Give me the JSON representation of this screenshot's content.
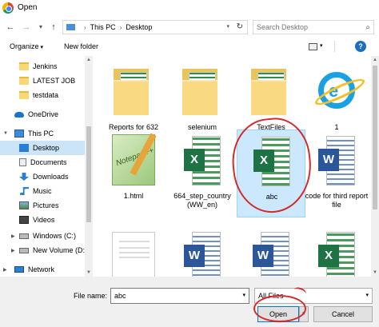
{
  "window": {
    "title": "Open"
  },
  "address": {
    "breadcrumb": [
      "This PC",
      "Desktop"
    ],
    "search_placeholder": "Search Desktop"
  },
  "toolbar": {
    "organize": "Organize",
    "new_folder": "New folder"
  },
  "nav": {
    "items": [
      {
        "label": "Jenkins",
        "icon": "folder-icon"
      },
      {
        "label": "LATEST JOB",
        "icon": "folder-icon"
      },
      {
        "label": "testdata",
        "icon": "folder-icon"
      },
      {
        "label": "OneDrive",
        "icon": "onedrive-icon"
      },
      {
        "label": "This PC",
        "icon": "computer-icon"
      },
      {
        "label": "Desktop",
        "icon": "desktop-icon",
        "selected": true
      },
      {
        "label": "Documents",
        "icon": "documents-icon"
      },
      {
        "label": "Downloads",
        "icon": "downloads-icon"
      },
      {
        "label": "Music",
        "icon": "music-icon"
      },
      {
        "label": "Pictures",
        "icon": "pictures-icon"
      },
      {
        "label": "Videos",
        "icon": "videos-icon"
      },
      {
        "label": "Windows (C:)",
        "icon": "drive-icon"
      },
      {
        "label": "New Volume (D:)",
        "icon": "drive-icon"
      },
      {
        "label": "Network",
        "icon": "network-icon"
      }
    ]
  },
  "files": [
    {
      "label": "Reports for 632",
      "type": "folder"
    },
    {
      "label": "selenium",
      "type": "folder"
    },
    {
      "label": "TextFiles",
      "type": "folder"
    },
    {
      "label": "1",
      "type": "internet-shortcut"
    },
    {
      "label": "1.html",
      "type": "html"
    },
    {
      "label": "664_step_country (WW_en)",
      "type": "excel"
    },
    {
      "label": "abc",
      "type": "excel",
      "selected": true
    },
    {
      "label": "code for third report file",
      "type": "word"
    },
    {
      "label": "",
      "type": "html-preview"
    },
    {
      "label": "",
      "type": "word"
    },
    {
      "label": "",
      "type": "word"
    },
    {
      "label": "",
      "type": "excel"
    }
  ],
  "bottom": {
    "file_name_label": "File name:",
    "file_name_value": "abc",
    "file_type": "All Files",
    "open_label": "Open",
    "cancel_label": "Cancel"
  },
  "colors": {
    "selection": "#cce8ff",
    "annotation": "#d62a2a",
    "excel": "#1f7244",
    "word": "#2b579a"
  }
}
